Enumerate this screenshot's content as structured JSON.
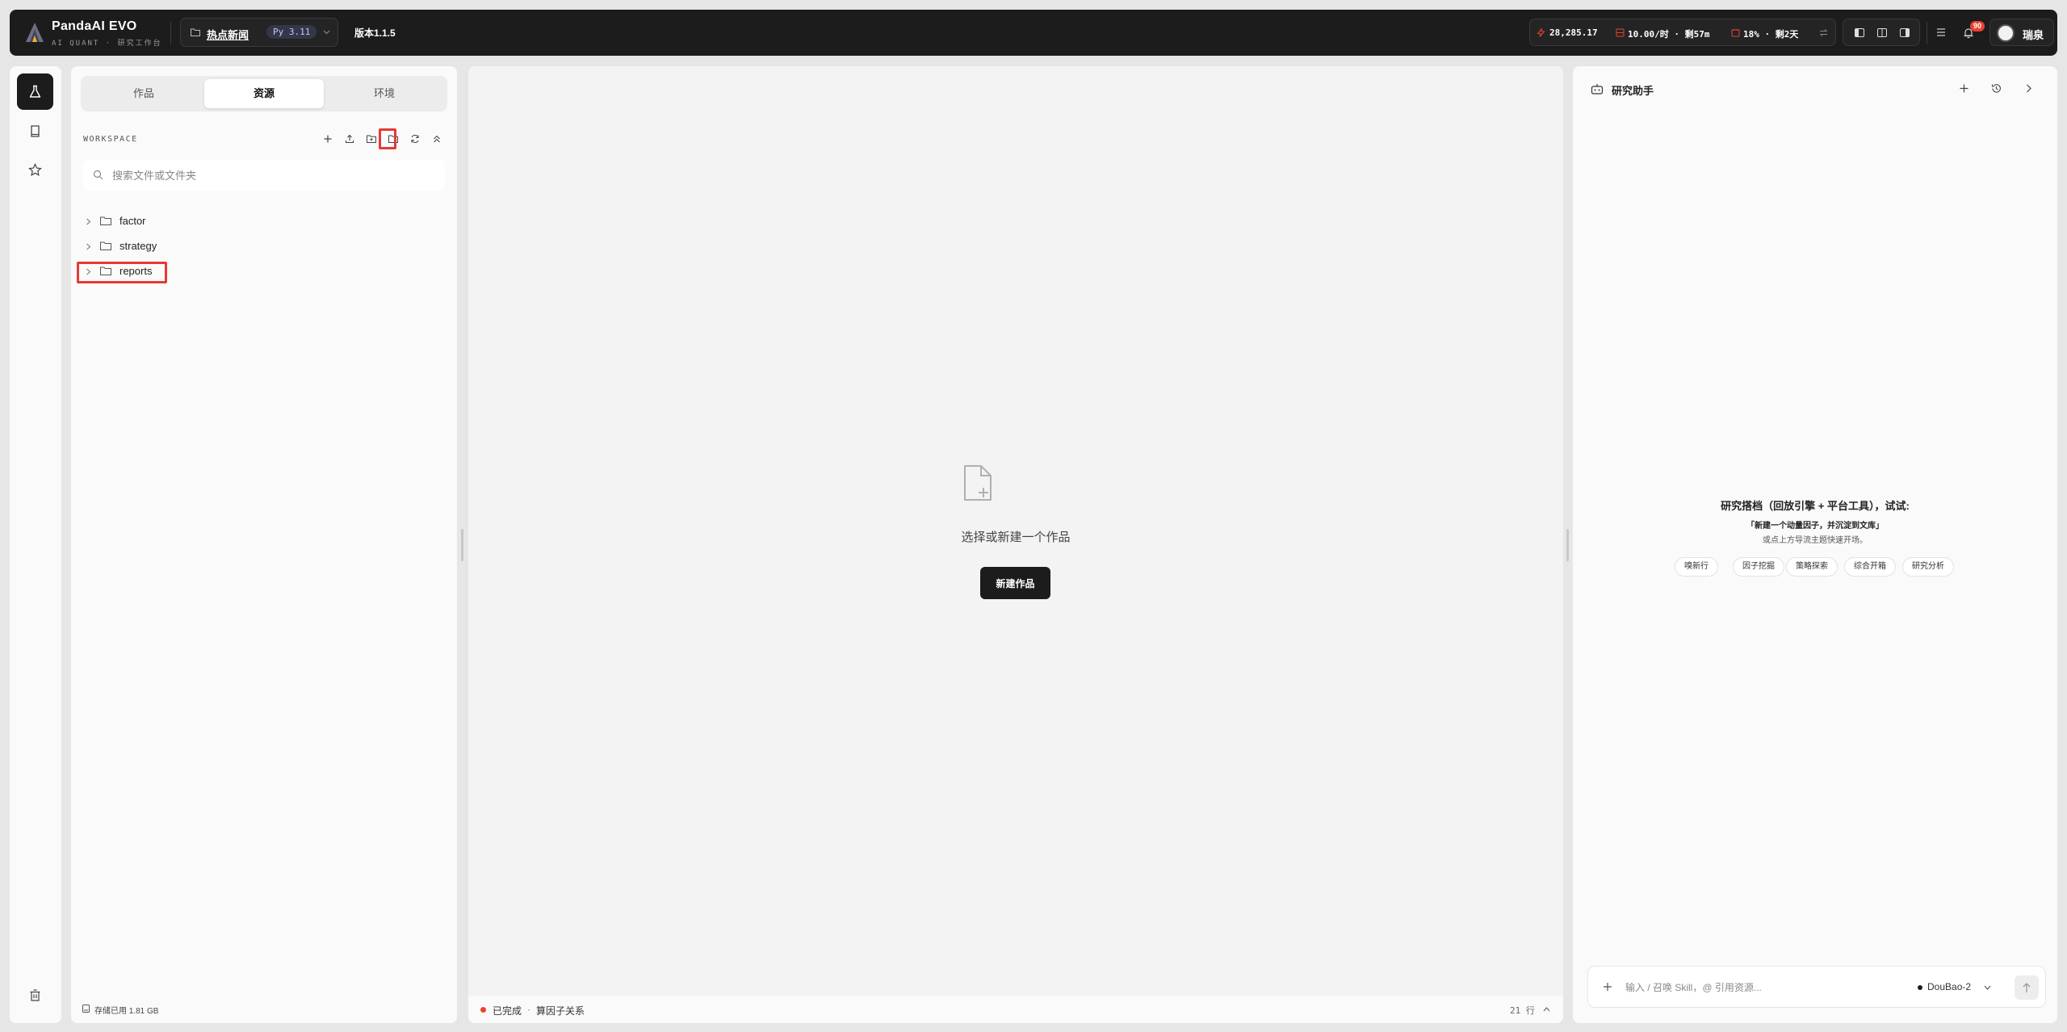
{
  "app": {
    "brand_title": "PandaAI EVO",
    "brand_subtitle": "AI QUANT · 研究工作台",
    "project_name": "热点新闻",
    "python_version": "Py 3.11",
    "version": "版本1.1.5"
  },
  "header_stats": {
    "points": "28,285.17",
    "rate": "10.00/时 · 剩57m",
    "usage": "18% · 剩2天"
  },
  "notifications": {
    "count": "90"
  },
  "user": {
    "name": "瑞泉"
  },
  "file_panel": {
    "tabs": [
      {
        "label": "作品",
        "active": false
      },
      {
        "label": "资源",
        "active": true
      },
      {
        "label": "环境",
        "active": false
      }
    ],
    "workspace_label": "WORKSPACE",
    "search_placeholder": "搜索文件或文件夹",
    "tree": [
      {
        "label": "factor"
      },
      {
        "label": "strategy"
      },
      {
        "label": "reports"
      }
    ],
    "storage": "存储已用 1.81 GB"
  },
  "main": {
    "empty_text": "选择或新建一个作品",
    "new_button": "新建作品",
    "status": "已完成",
    "status_sep": "·",
    "status_detail": "算因子关系",
    "lines": "21 行"
  },
  "assistant": {
    "title": "研究助手",
    "heading": "研究搭档（回放引擎 + 平台工具），试试:",
    "example": "「新建一个动量因子，并沉淀到文库」",
    "hint": "或点上方导流主题快速开场。",
    "chips": [
      "嗅新行",
      "因子挖掘",
      "策略探索",
      "综合开箱",
      "研究分析"
    ],
    "input_placeholder": "输入 / 召唤 Skill，@ 引用资源...",
    "model": "DouBao-2"
  },
  "colors": {
    "topbar_bg": "#1c1c1c",
    "accent_red": "#e8432f",
    "highlight_red": "#e53935",
    "python_pill_bg": "#34364a"
  },
  "icons": {
    "rail": [
      "flask-icon",
      "book-icon",
      "star-icon",
      "trash-icon"
    ],
    "workspace_tools": [
      "plus-icon",
      "upload-icon",
      "new-folder-icon",
      "folder-icon",
      "refresh-icon",
      "collapse-all-icon"
    ]
  }
}
